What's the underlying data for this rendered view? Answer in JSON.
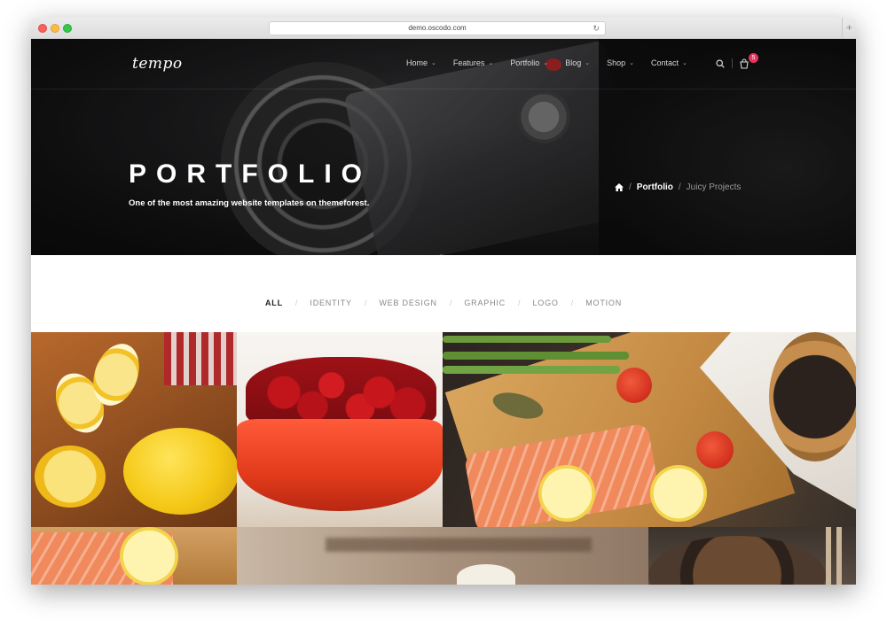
{
  "browser": {
    "url": "demo.oscodo.com",
    "new_tab": "+"
  },
  "site": {
    "logo": "tempo",
    "nav": [
      {
        "label": "Home"
      },
      {
        "label": "Features"
      },
      {
        "label": "Portfolio"
      },
      {
        "label": "Blog"
      },
      {
        "label": "Shop"
      },
      {
        "label": "Contact"
      }
    ],
    "cart_count": "5",
    "icons": [
      "search-icon",
      "cart-icon",
      "home-icon"
    ]
  },
  "hero": {
    "title": "PORTFOLIO",
    "subtitle": "One of the most amazing website templates on themeforest.",
    "breadcrumb": {
      "sep1": "/",
      "current": "Portfolio",
      "sep2": "/",
      "last": "Juicy Projects"
    }
  },
  "filters": [
    {
      "label": "ALL"
    },
    {
      "label": "IDENTITY"
    },
    {
      "label": "WEB DESIGN"
    },
    {
      "label": "GRAPHIC"
    },
    {
      "label": "LOGO"
    },
    {
      "label": "MOTION"
    }
  ],
  "filter_sep": "/",
  "colors": {
    "badge": "#e8345b",
    "active_filter": "#222222",
    "inactive_filter": "#888888"
  }
}
